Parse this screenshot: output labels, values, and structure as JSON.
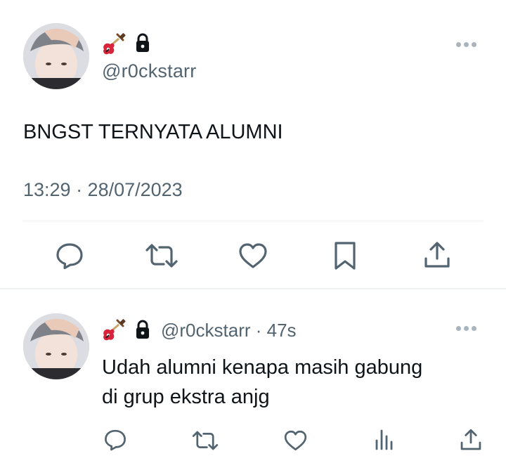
{
  "main_tweet": {
    "handle": "@r0ckstarr",
    "text": "BNGST TERNYATA ALUMNI",
    "timestamp": "13:29 · 28/07/2023"
  },
  "reply": {
    "handle": "@r0ckstarr",
    "separator": " · ",
    "time_ago": "47s",
    "text_line1": "Udah alumni kenapa masih gabung",
    "text_line2": "di grup ekstra anjg"
  },
  "icons": {
    "name_emoji": "guitar-icon",
    "protected": "lock-icon",
    "more": "more-icon",
    "actions_main": [
      "reply-icon",
      "retweet-icon",
      "like-icon",
      "bookmark-icon",
      "share-icon"
    ],
    "actions_reply": [
      "reply-icon",
      "retweet-icon",
      "like-icon",
      "analytics-icon",
      "share-icon"
    ]
  },
  "colors": {
    "text": "#0f1419",
    "secondary": "#536471",
    "icon": "#536471",
    "divider": "#eff3f4"
  }
}
